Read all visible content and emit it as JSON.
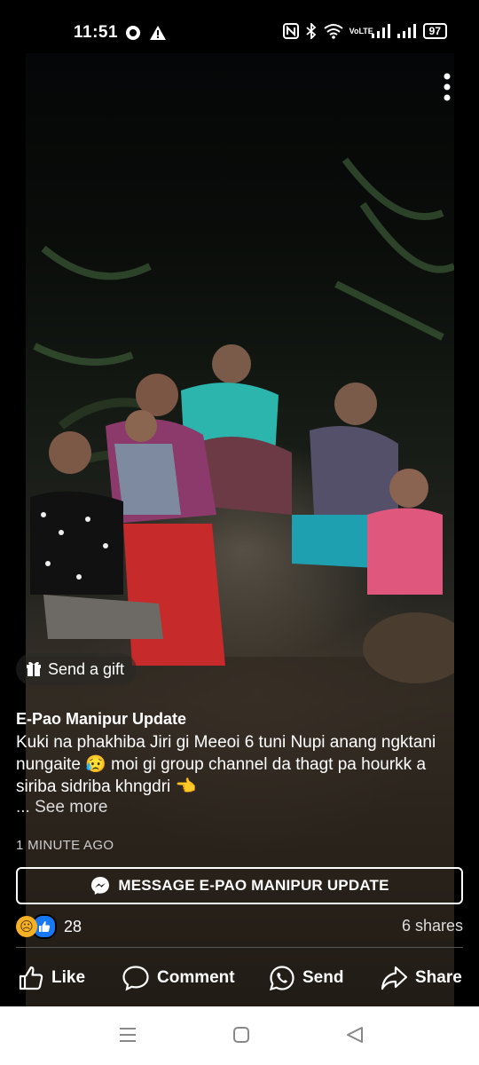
{
  "status_bar": {
    "time": "11:51",
    "battery": "97",
    "network": "VoLTE"
  },
  "post": {
    "gift_label": "Send a gift",
    "author": "E-Pao Manipur Update",
    "caption": "Kuki na phakhiba Jiri gi Meeoi 6 tuni Nupi anang ngktani nungaite 😥 moi gi group channel da thagt pa hourkk a siriba sidriba khngdri 👈",
    "see_more": "... See more",
    "timestamp": "1 MINUTE AGO",
    "message_button": "MESSAGE E-PAO MANIPUR UPDATE",
    "reaction_count": "28",
    "shares": "6 shares"
  },
  "actions": {
    "like": "Like",
    "comment": "Comment",
    "send": "Send",
    "share": "Share"
  },
  "colors": {
    "background": "#000000",
    "text": "#ffffff",
    "like_blue": "#1877f2",
    "nav_bar": "#ffffff"
  }
}
